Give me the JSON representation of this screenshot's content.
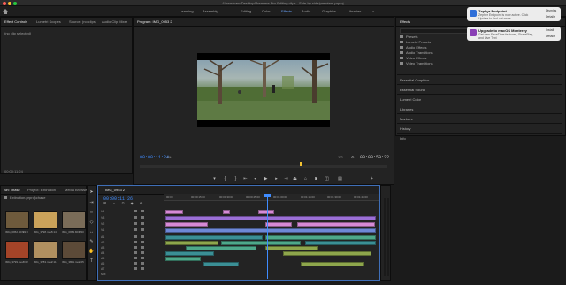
{
  "window": {
    "title": "/Users/sam/Desktop/Premiere Pro Editing clips - Side-by-side/premiere.prproj"
  },
  "workspaces": {
    "items": [
      "Learning",
      "Assembly",
      "Editing",
      "Color",
      "Effects",
      "Audio",
      "Graphics",
      "Libraries"
    ],
    "active": "Effects"
  },
  "left_panel": {
    "tabs": [
      "Effect Controls",
      "Lumetri Scopes",
      "Source: (no clips)",
      "Audio Clip Mixer"
    ],
    "no_clip": "(no clip selected)",
    "timecode": "00:00:11:24"
  },
  "program_monitor": {
    "tab": "Program: IMG_0953 2",
    "timecode": "00:00:11:24",
    "fit": "Fit",
    "zoom": "1/2",
    "duration": "00:00:59:22"
  },
  "effects_panel": {
    "tab": "Effects",
    "search_placeholder": "",
    "folders": [
      "Presets",
      "Lumetri Presets",
      "Audio Effects",
      "Audio Transitions",
      "Video Effects",
      "Video Transitions"
    ],
    "sections": [
      "Essential Graphics",
      "Essential Sound",
      "Lumetri Color",
      "Libraries",
      "Markers",
      "History",
      "Info"
    ]
  },
  "notifications": [
    {
      "app": "Zephyr Endpoint",
      "body": "Zephyr Endpoint is now active. Click Update to find out more",
      "action1": "Dismiss",
      "action2": "Details",
      "color": "#2f6fd8"
    },
    {
      "app": "Upgrade to macOS Monterey",
      "body": "Get new FaceTime features, SharePlay, and Live Text",
      "action1": "Install",
      "action2": "Details",
      "color": "#8a3fb5"
    }
  ],
  "project_panel": {
    "tabs": [
      "Bin: chase",
      "Project: Extinction",
      "Media Browser"
    ],
    "path": "Extinction.prproj\\chase",
    "clips": [
      {
        "name": "IMG_0952.MOV",
        "dur": "12:0",
        "color": "#6e5a3c"
      },
      {
        "name": "IMG_3798.mov",
        "dur": "5:14",
        "color": "#caa25a"
      },
      {
        "name": "IMG_0953.MOV",
        "dur": "3:20",
        "color": "#7a6c58"
      },
      {
        "name": "IMG_3799.mov",
        "dur": "8:02",
        "color": "#a44428"
      },
      {
        "name": "IMG_3783.mov",
        "dur": "2:11",
        "color": "#b09060"
      },
      {
        "name": "IMG_3801.mov",
        "dur": "4:05",
        "color": "#5c4a38"
      }
    ]
  },
  "timeline": {
    "tab": "IMG_0953 2",
    "timecode": "00:00:11:26",
    "ruler": [
      "00:00",
      "00:00:15:00",
      "00:00:30:00",
      "00:00:45:00",
      "00:01:00:00",
      "00:01:15:00",
      "00:01:30:00",
      "00:01:45:00"
    ],
    "video_tracks": [
      "V4",
      "V3",
      "V2",
      "V1"
    ],
    "audio_tracks": [
      "A1",
      "A2",
      "A3",
      "A4",
      "A5",
      "A6",
      "A7",
      "A8",
      "Mix"
    ]
  }
}
